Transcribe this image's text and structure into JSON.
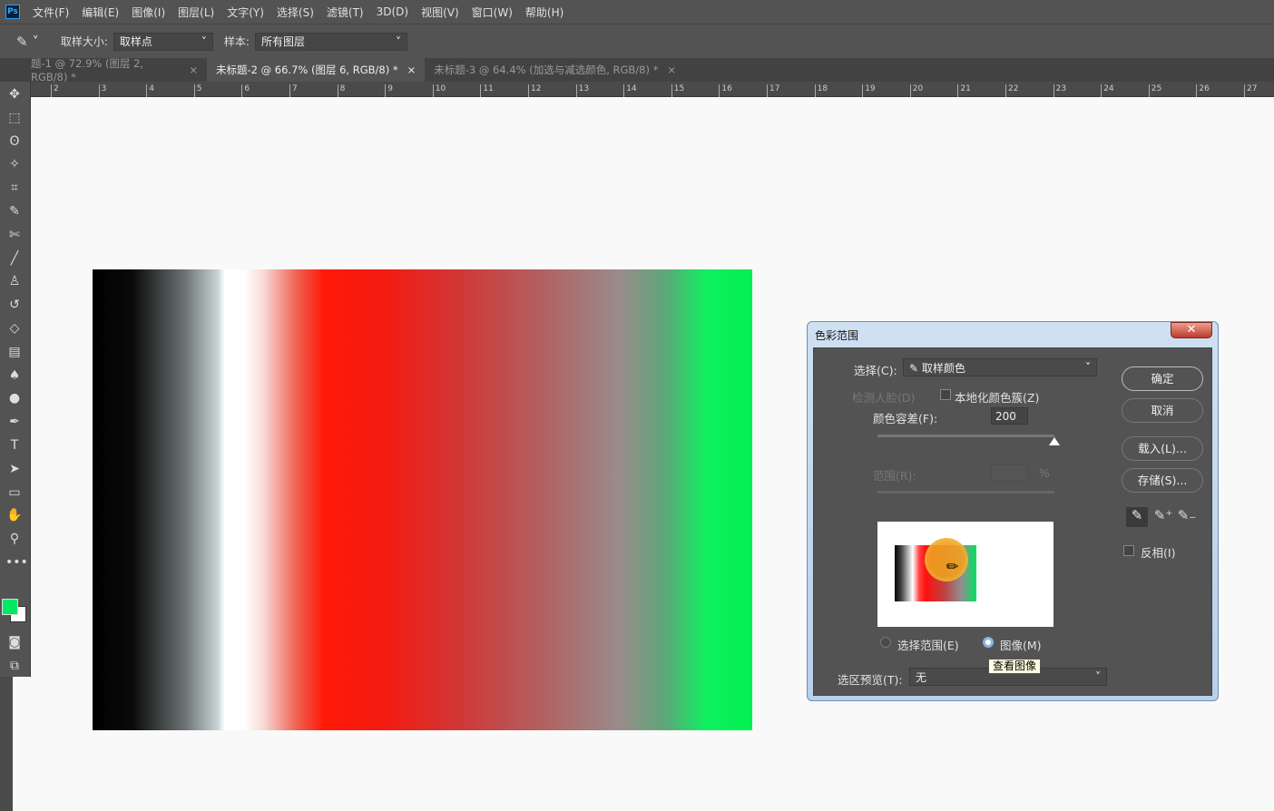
{
  "app": {
    "logo": "Ps"
  },
  "menu": [
    "文件(F)",
    "编辑(E)",
    "图像(I)",
    "图层(L)",
    "文字(Y)",
    "选择(S)",
    "滤镜(T)",
    "3D(D)",
    "视图(V)",
    "窗口(W)",
    "帮助(H)"
  ],
  "options": {
    "sample_size_label": "取样大小:",
    "sample_size_value": "取样点",
    "sample_label": "样本:",
    "sample_value": "所有图层"
  },
  "tabs": [
    {
      "label": "题-1 @ 72.9% (图层 2, RGB/8) *",
      "active": false
    },
    {
      "label": "未标题-2 @ 66.7% (图层 6, RGB/8) *",
      "active": true
    },
    {
      "label": "未标题-3 @ 64.4% (加选与减选颜色, RGB/8) *",
      "active": false
    }
  ],
  "ruler": [
    "2",
    "3",
    "4",
    "5",
    "6",
    "7",
    "8",
    "9",
    "10",
    "11",
    "12",
    "13",
    "14",
    "15",
    "16",
    "17",
    "18",
    "19",
    "20",
    "21",
    "22",
    "23",
    "24",
    "25",
    "26",
    "27"
  ],
  "colors": {
    "foreground": "#00e864",
    "background": "#ffffff"
  },
  "dialog": {
    "title": "色彩范围",
    "close": "✕",
    "select_label": "选择(C):",
    "select_value": "取样颜色",
    "detect_faces": "检测人脸(D)",
    "localized": "本地化颜色簇(Z)",
    "fuzziness_label": "颜色容差(F):",
    "fuzziness_value": "200",
    "fuzziness_fraction": 1.0,
    "range_label": "范围(R):",
    "range_unit": "%",
    "ok": "确定",
    "cancel": "取消",
    "load": "载入(L)...",
    "save": "存储(S)...",
    "invert": "反相(I)",
    "radio_selection": "选择范围(E)",
    "radio_image": "图像(M)",
    "tooltip": "查看图像",
    "preview_label": "选区预览(T):",
    "preview_value": "无"
  }
}
